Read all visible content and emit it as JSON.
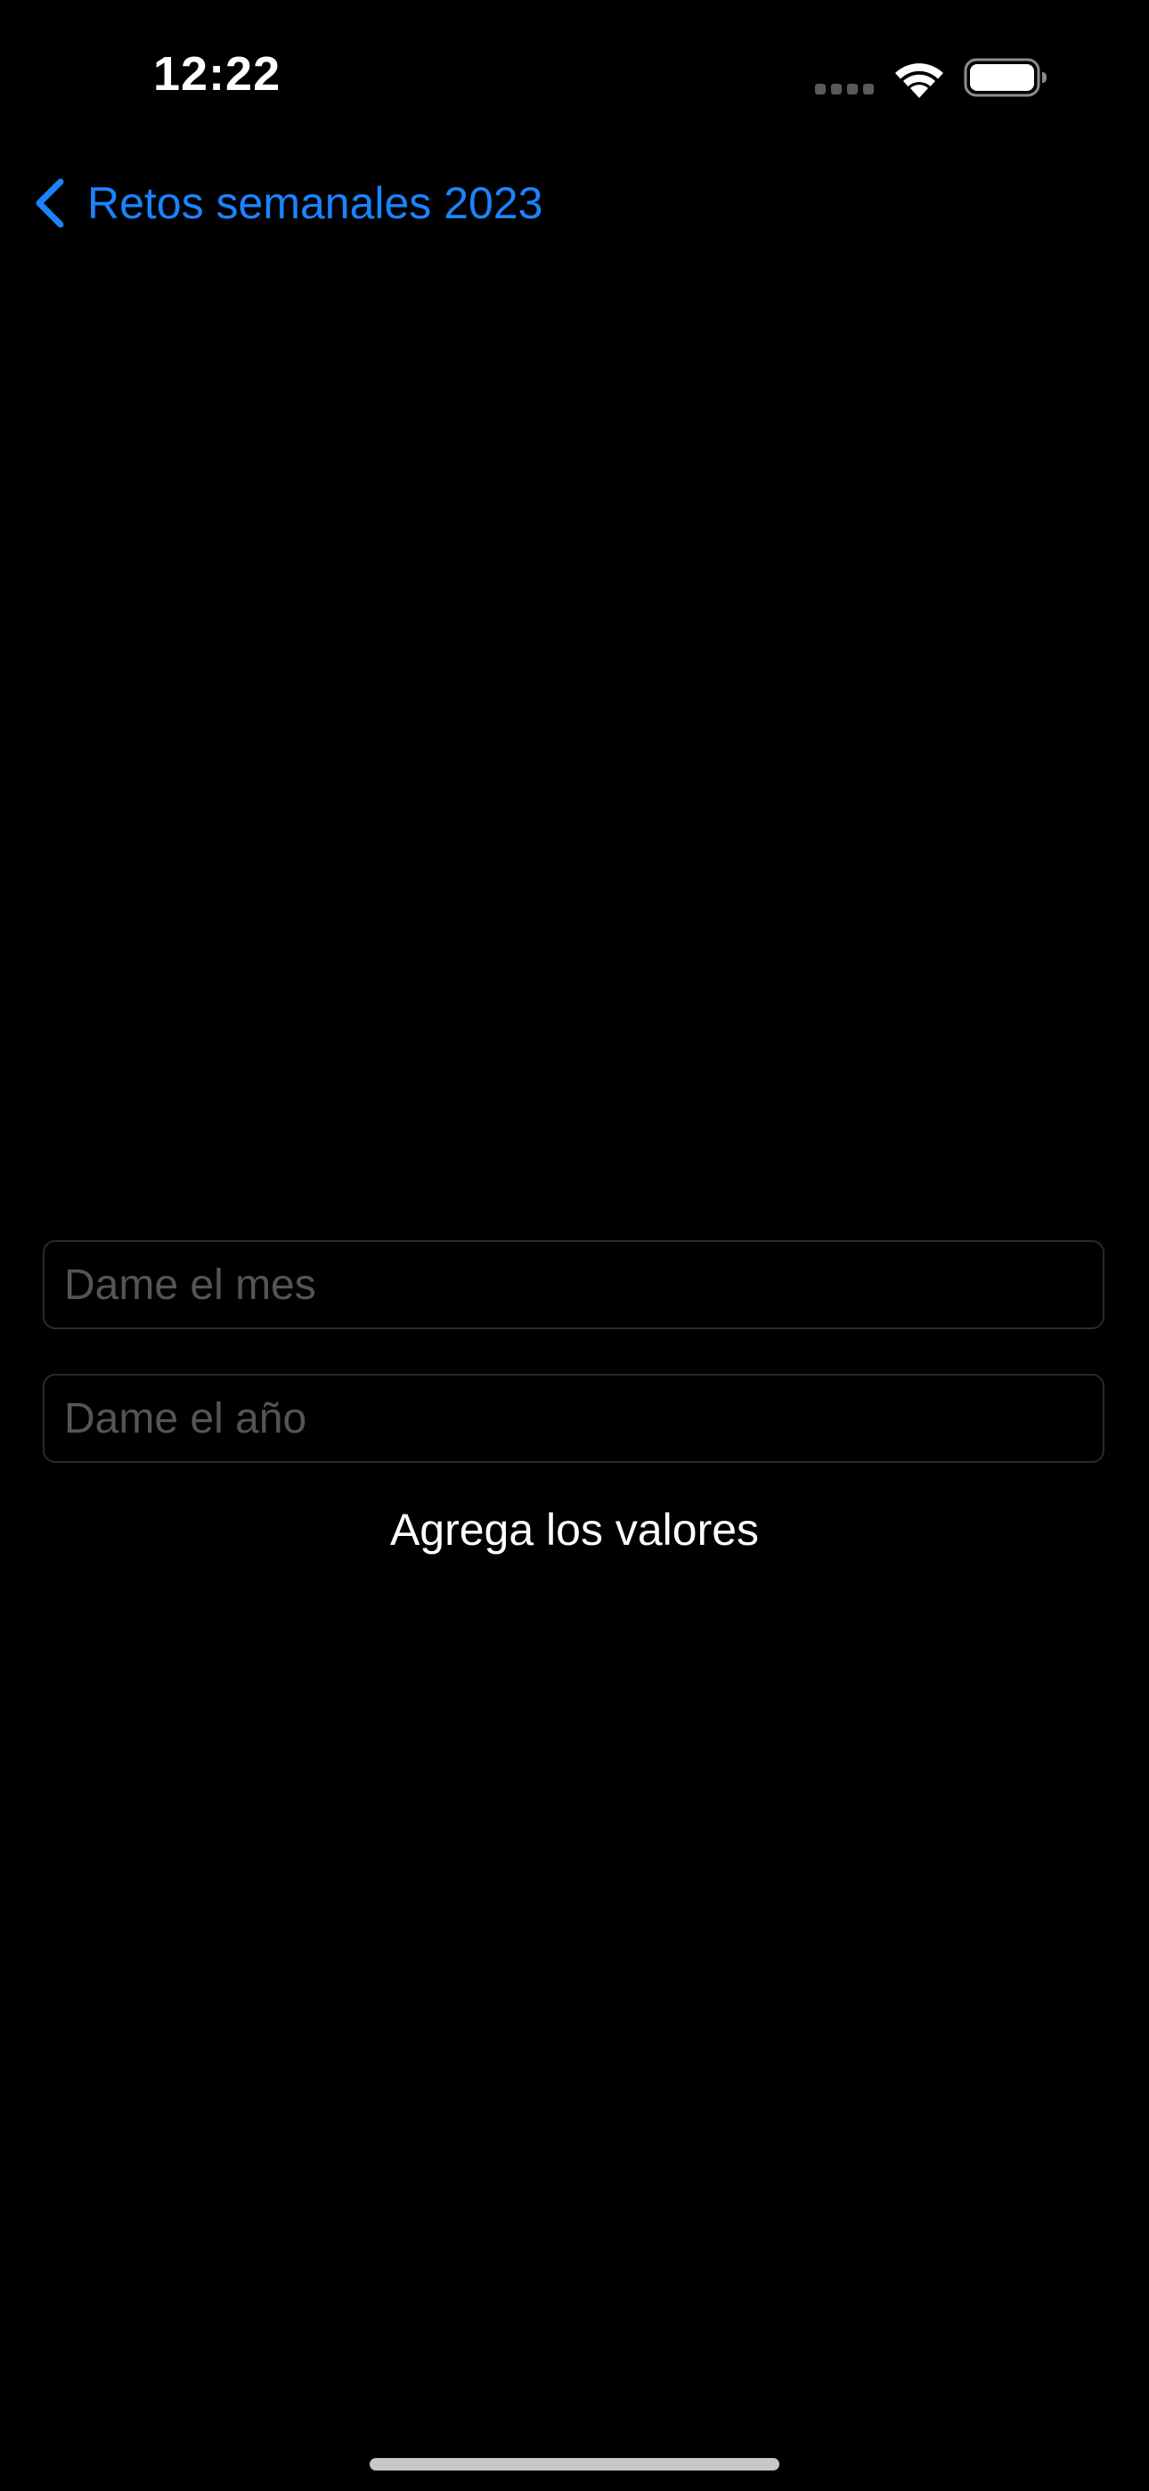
{
  "status_bar": {
    "time": "12:22",
    "signal_icon": "cellular-signal-icon",
    "wifi_icon": "wifi-icon",
    "battery_icon": "battery-icon"
  },
  "nav": {
    "back_label": "Retos semanales 2023",
    "back_icon": "chevron-left-icon",
    "accent_color": "#1a84ff"
  },
  "form": {
    "month_field": {
      "value": "",
      "placeholder": "Dame el mes"
    },
    "year_field": {
      "value": "",
      "placeholder": "Dame el año"
    },
    "submit_label": "Agrega los valores"
  }
}
